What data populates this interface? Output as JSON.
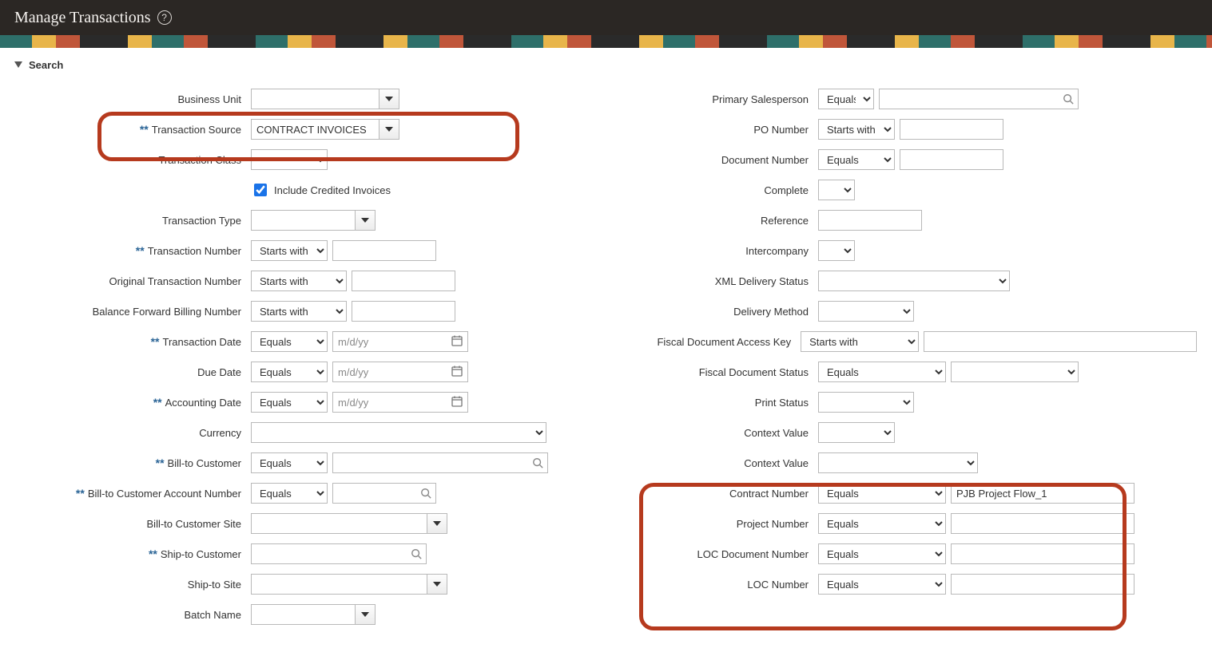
{
  "header": {
    "title": "Manage Transactions"
  },
  "search": {
    "heading": "Search"
  },
  "left": {
    "business_unit": {
      "label": "Business Unit",
      "value": ""
    },
    "transaction_source": {
      "label": "Transaction Source",
      "value": "CONTRACT INVOICES"
    },
    "transaction_class": {
      "label": "Transaction Class",
      "value": ""
    },
    "include_credited": {
      "label": "Include Credited Invoices",
      "checked": true
    },
    "transaction_type": {
      "label": "Transaction Type",
      "value": ""
    },
    "transaction_number": {
      "label": "Transaction Number",
      "op": "Starts with",
      "value": ""
    },
    "original_txn_number": {
      "label": "Original Transaction Number",
      "op": "Starts with",
      "value": ""
    },
    "balance_fwd_billing": {
      "label": "Balance Forward Billing Number",
      "op": "Starts with",
      "value": ""
    },
    "transaction_date": {
      "label": "Transaction Date",
      "op": "Equals",
      "placeholder": "m/d/yy",
      "value": ""
    },
    "due_date": {
      "label": "Due Date",
      "op": "Equals",
      "placeholder": "m/d/yy",
      "value": ""
    },
    "accounting_date": {
      "label": "Accounting Date",
      "op": "Equals",
      "placeholder": "m/d/yy",
      "value": ""
    },
    "currency": {
      "label": "Currency",
      "value": ""
    },
    "bill_to_customer": {
      "label": "Bill-to Customer",
      "op": "Equals",
      "value": ""
    },
    "bill_to_acct": {
      "label": "Bill-to Customer Account Number",
      "op": "Equals",
      "value": ""
    },
    "bill_to_site": {
      "label": "Bill-to Customer Site",
      "value": ""
    },
    "ship_to_customer": {
      "label": "Ship-to Customer",
      "value": ""
    },
    "ship_to_site": {
      "label": "Ship-to Site",
      "value": ""
    },
    "batch_name": {
      "label": "Batch Name",
      "value": ""
    }
  },
  "right": {
    "primary_salesperson": {
      "label": "Primary Salesperson",
      "op": "Equals",
      "value": ""
    },
    "po_number": {
      "label": "PO Number",
      "op": "Starts with",
      "value": ""
    },
    "document_number": {
      "label": "Document Number",
      "op": "Equals",
      "value": ""
    },
    "complete": {
      "label": "Complete",
      "value": ""
    },
    "reference": {
      "label": "Reference",
      "value": ""
    },
    "intercompany": {
      "label": "Intercompany",
      "value": ""
    },
    "xml_delivery": {
      "label": "XML Delivery Status",
      "value": ""
    },
    "delivery_method": {
      "label": "Delivery Method",
      "value": ""
    },
    "fiscal_access_key": {
      "label": "Fiscal Document Access Key",
      "op": "Starts with",
      "value": ""
    },
    "fiscal_status": {
      "label": "Fiscal Document Status",
      "op": "Equals",
      "value": ""
    },
    "print_status": {
      "label": "Print Status",
      "value": ""
    },
    "context_value1": {
      "label": "Context Value",
      "value": ""
    },
    "context_value2": {
      "label": "Context Value",
      "value": ""
    },
    "contract_number": {
      "label": "Contract Number",
      "op": "Equals",
      "value": "PJB Project Flow_1"
    },
    "project_number": {
      "label": "Project Number",
      "op": "Equals",
      "value": ""
    },
    "loc_doc_number": {
      "label": "LOC Document Number",
      "op": "Equals",
      "value": ""
    },
    "loc_number": {
      "label": "LOC Number",
      "op": "Equals",
      "value": ""
    }
  }
}
